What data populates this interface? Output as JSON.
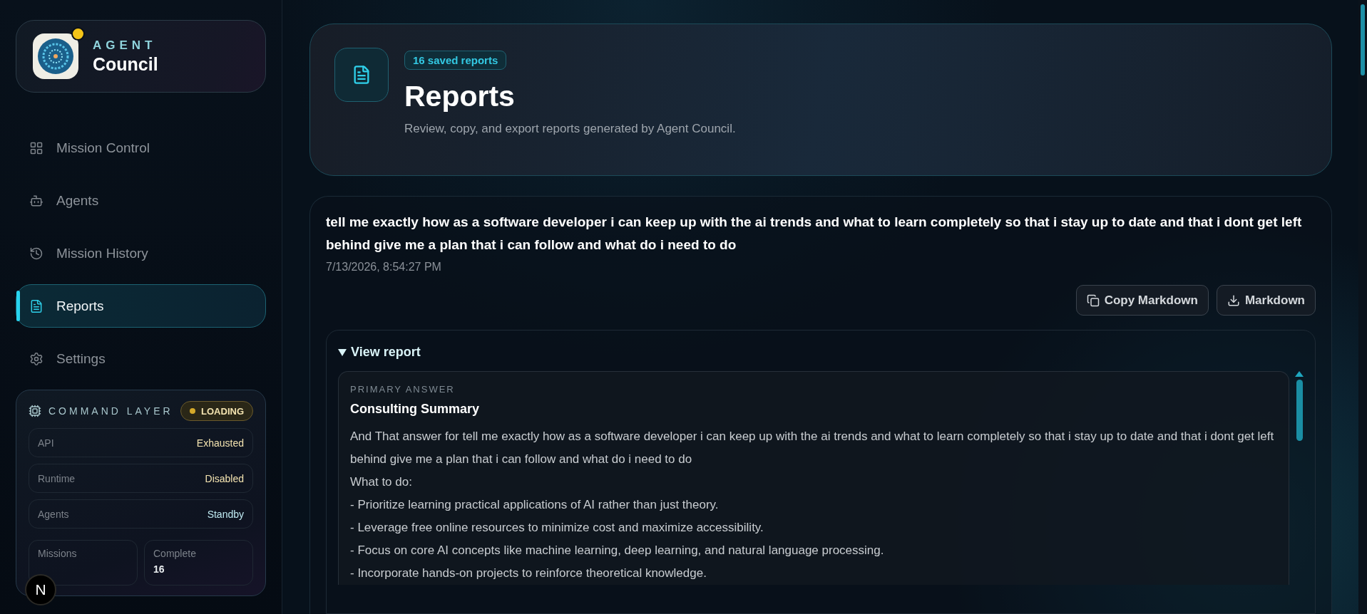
{
  "brand": {
    "overline": "AGENT",
    "name": "Council",
    "status_dot": {
      "color": "#f5c518"
    }
  },
  "nav": [
    {
      "label": "Mission Control",
      "selected": false
    },
    {
      "label": "Agents",
      "selected": false
    },
    {
      "label": "Mission History",
      "selected": false
    },
    {
      "label": "Reports",
      "selected": true
    },
    {
      "label": "Settings",
      "selected": false
    }
  ],
  "command_layer": {
    "title": "COMMAND LAYER",
    "badge": {
      "label": "LOADING",
      "color": "#d4a92a"
    },
    "rows": [
      {
        "label": "API",
        "value": "Exhausted",
        "color": "#f3e3b0"
      },
      {
        "label": "Runtime",
        "value": "Disabled",
        "color": "#f3e3b0"
      },
      {
        "label": "Agents",
        "value": "Standby",
        "color": "#bfeaf2"
      }
    ],
    "stats": [
      {
        "label": "Missions"
      },
      {
        "label": "Complete",
        "value": "16"
      }
    ]
  },
  "header": {
    "badge": "16 saved reports",
    "title": "Reports",
    "subtitle": "Review, copy, and export reports generated by Agent Council."
  },
  "report": {
    "question": "tell me exactly how as a software developer i can keep up with the ai trends and what to learn completely so that i stay up to date and that i dont get left behind give me a plan that i can follow and what do i need to do",
    "timestamp": "7/13/2026, 8:54:27 PM",
    "buttons": [
      "Copy Markdown",
      "Markdown"
    ],
    "details": {
      "summary": "View report",
      "expanded": true,
      "eyebrow": "PRIMARY ANSWER",
      "heading": "Consulting Summary",
      "lines": [
        "And That answer for tell me exactly how as a software developer i can keep up with the ai trends and what to learn completely so that i stay up to date and that i dont get left behind give me a plan that i can follow and what do i need to do",
        "What to do:",
        "- Prioritize learning practical applications of AI rather than just theory.",
        "- Leverage free online resources to minimize cost and maximize accessibility.",
        "- Focus on core AI concepts like machine learning, deep learning, and natural language processing.",
        "- Incorporate hands-on projects to reinforce theoretical knowledge."
      ]
    }
  },
  "dev_badge": {
    "letter": "N"
  }
}
